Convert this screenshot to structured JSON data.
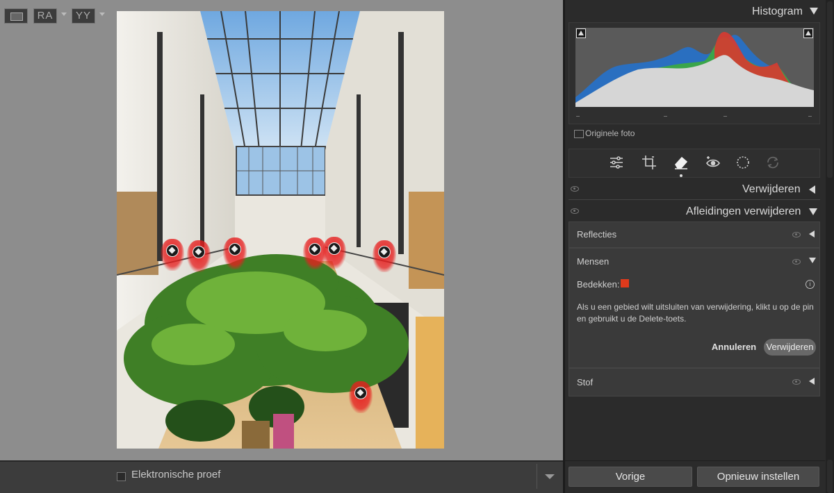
{
  "canvas": {
    "photo_subject": "shopping-mall-atrium-photo",
    "pins_color": "#e61e1e"
  },
  "toolbar": {
    "view_ra": "RA",
    "view_yy": "YY",
    "proof_label": "Elektronische proef"
  },
  "panel": {
    "histogram": {
      "title": "Histogram",
      "original_photo_label": "Originele foto"
    },
    "tools": [
      "sliders-icon",
      "crop-icon",
      "eraser-icon",
      "red-eye-icon",
      "masking-icon",
      "presets-icon"
    ],
    "sections": {
      "remove_title": "Verwijderen",
      "distractions_title": "Afleidingen verwijderen"
    },
    "subsections": {
      "reflections": "Reflecties",
      "people": "Mensen",
      "cover_label": "Bedekken:",
      "cover_color": "#e03a1c",
      "help_text": "Als u een gebied wilt uitsluiten van verwijdering, klikt u op de pin en gebruikt u de Delete-toets.",
      "cancel_label": "Annuleren",
      "remove_label": "Verwijderen",
      "dust": "Stof"
    },
    "footer": {
      "prev_label": "Vorige",
      "reset_label": "Opnieuw instellen"
    }
  }
}
